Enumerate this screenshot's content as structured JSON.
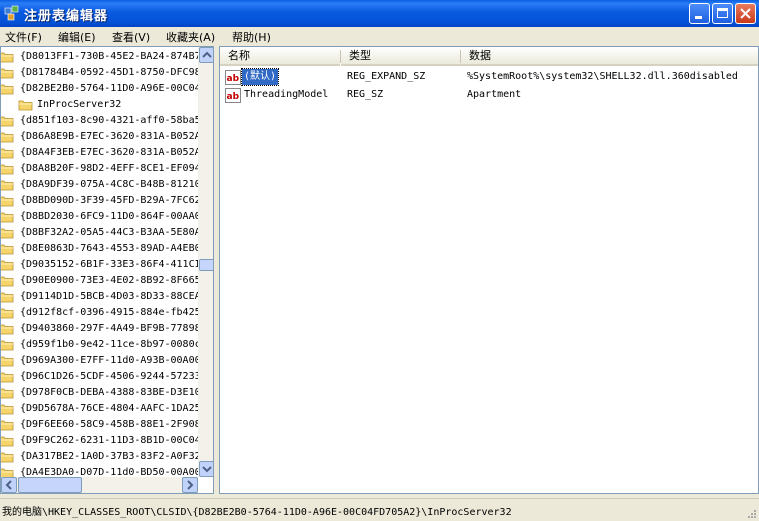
{
  "window": {
    "title": "注册表编辑器",
    "icon": "regedit-icon"
  },
  "menu": [
    {
      "label": "文件(F)"
    },
    {
      "label": "编辑(E)"
    },
    {
      "label": "查看(V)"
    },
    {
      "label": "收藏夹(A)"
    },
    {
      "label": "帮助(H)"
    }
  ],
  "tree": {
    "items": [
      {
        "label": "{D8013FF1-730B-45E2-BA24-874B7"
      },
      {
        "label": "{D81784B4-0592-45D1-8750-DFC98"
      },
      {
        "label": "{D82BE2B0-5764-11D0-A96E-00C04"
      },
      {
        "label": "InProcServer32",
        "child": true
      },
      {
        "label": "{d851f103-8c90-4321-aff0-58ba5"
      },
      {
        "label": "{D86A8E9B-E7EC-3620-831A-B052A"
      },
      {
        "label": "{D8A4F3EB-E7EC-3620-831A-B052A"
      },
      {
        "label": "{D8A8B20F-98D2-4EFF-8CE1-EF094"
      },
      {
        "label": "{D8A9DF39-075A-4C8C-B48B-81210"
      },
      {
        "label": "{D8BD090D-3F39-45FD-B29A-7FC62"
      },
      {
        "label": "{D8BD2030-6FC9-11D0-864F-00AA0"
      },
      {
        "label": "{D8BF32A2-05A5-44C3-B3AA-5E80A"
      },
      {
        "label": "{D8E0863D-7643-4553-89AD-A4EB0"
      },
      {
        "label": "{D9035152-6B1F-33E3-86F4-411CI"
      },
      {
        "label": "{D90E0900-73E3-4E02-8B92-8F665"
      },
      {
        "label": "{D9114D1D-5BCB-4D03-8D33-88CEA"
      },
      {
        "label": "{d912f8cf-0396-4915-884e-fb425"
      },
      {
        "label": "{D9403860-297F-4A49-BF9B-77898"
      },
      {
        "label": "{d959f1b0-9e42-11ce-8b97-0080c"
      },
      {
        "label": "{D969A300-E7FF-11d0-A93B-00A00"
      },
      {
        "label": "{D96C1D26-5CDF-4506-9244-57233"
      },
      {
        "label": "{D978F0CB-DEBA-4388-83BE-D3E10"
      },
      {
        "label": "{D9D5678A-76CE-4804-AAFC-1DA25"
      },
      {
        "label": "{D9F6EE60-58C9-458B-88E1-2F908"
      },
      {
        "label": "{D9F9C262-6231-11D3-8B1D-00C04"
      },
      {
        "label": "{DA317BE2-1A0D-37B3-83F2-A0F32"
      },
      {
        "label": "{DA4E3DA0-D07D-11d0-BD50-00A00"
      }
    ]
  },
  "list": {
    "columns": {
      "name": "名称",
      "type": "类型",
      "data": "数据"
    },
    "rows": [
      {
        "name": "(默认)",
        "type": "REG_EXPAND_SZ",
        "data": "%SystemRoot%\\system32\\SHELL32.dll.360disabled",
        "selected": true
      },
      {
        "name": "ThreadingModel",
        "type": "REG_SZ",
        "data": "Apartment",
        "selected": false
      }
    ]
  },
  "status": {
    "path": "我的电脑\\HKEY_CLASSES_ROOT\\CLSID\\{D82BE2B0-5764-11D0-A96E-00C04FD705A2}\\InProcServer32"
  },
  "colors": {
    "titlebar": "#0a5ae0",
    "selection": "#316ac5",
    "folder": "#f5d46b"
  }
}
